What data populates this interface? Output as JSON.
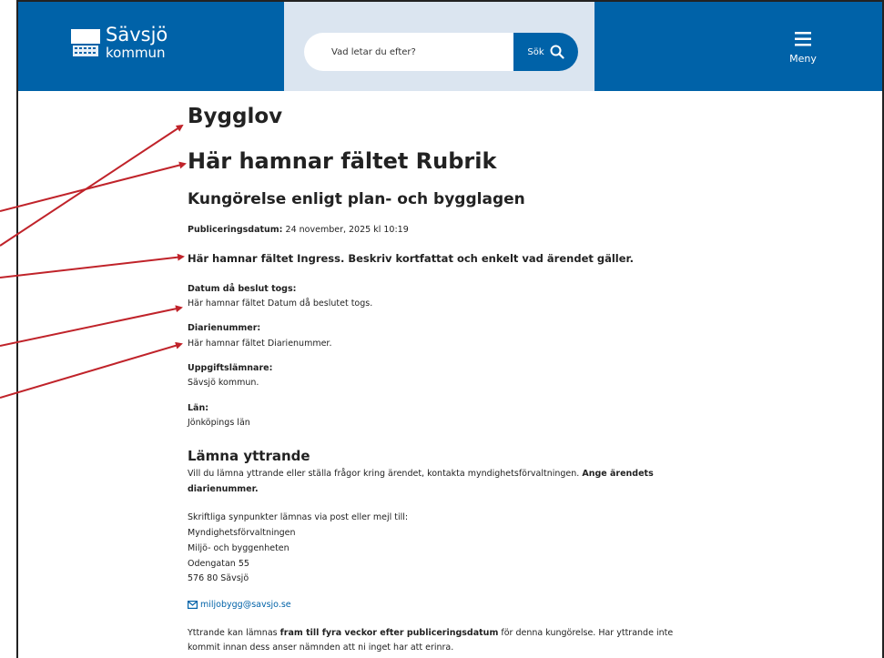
{
  "header": {
    "logo_line1": "Sävsjö",
    "logo_line2": "kommun",
    "search_placeholder": "Vad letar du efter?",
    "search_button": "Sök",
    "menu_label": "Meny",
    "colors": {
      "brand": "#0062a8",
      "search_band": "#dbe5f0"
    }
  },
  "page": {
    "category": "Bygglov",
    "title": "Här hamnar fältet Rubrik",
    "subtitle": "Kungörelse enligt plan- och bygglagen",
    "pubdate_label": "Publiceringsdatum:",
    "pubdate_value": "24 november, 2025 kl 10:19",
    "ingress": "Här hamnar fältet Ingress. Beskriv kortfattat  och enkelt vad ärendet gäller.",
    "fields": [
      {
        "label": "Datum då beslut togs:",
        "value": "Här hamnar fältet Datum då beslutet togs."
      },
      {
        "label": "Diarienummer:",
        "value": "Här hamnar fältet Diarienummer."
      },
      {
        "label": "Uppgiftslämnare:",
        "value": "Sävsjö kommun."
      },
      {
        "label": "Län:",
        "value": "Jönköpings län"
      }
    ],
    "section_title": "Lämna yttrande",
    "para1_text": "Vill du lämna yttrande eller ställa frågor kring ärendet, kontakta myndighetsförvaltningen.",
    "para1_bold_a": "Ange ärendets",
    "para1_bold_b": "diarienummer.",
    "address": [
      "Skriftliga synpunkter lämnas via post eller mejl till:",
      "Myndighetsförvaltningen",
      "Miljö- och byggenheten",
      "Odengatan 55",
      "576 80 Sävsjö"
    ],
    "email": "miljobygg@savsjo.se",
    "footer_a": "Yttrande kan lämnas",
    "footer_bold": "fram till fyra veckor efter publiceringsdatum",
    "footer_b": "för denna kungörelse. Har yttrande inte",
    "footer_line2": "kommit innan dess anser nämnden att ni inget har att erinra."
  },
  "annotation_color": "#c0232a"
}
